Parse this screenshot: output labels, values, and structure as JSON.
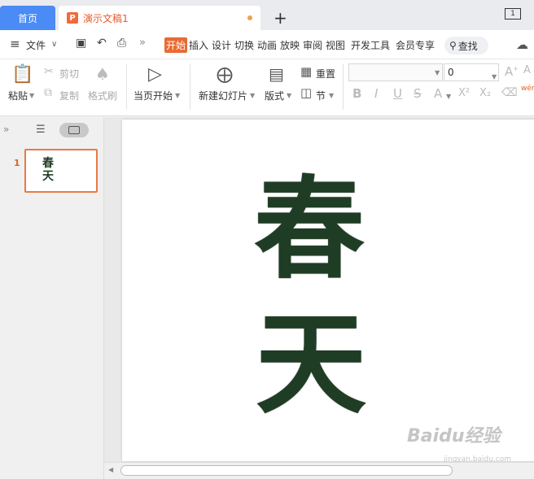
{
  "tabs": {
    "home_label": "首页",
    "doc_icon": "P",
    "doc_title": "演示文稿1",
    "new_tab": "+",
    "window_layout": "1"
  },
  "menu": {
    "hamburger_icon": "≡",
    "file_label": "文件",
    "file_arrow": "∨",
    "more_icon": "»",
    "tabs": [
      "开始",
      "插入",
      "设计",
      "切换",
      "动画",
      "放映",
      "审阅",
      "视图",
      "开发工具",
      "会员专享"
    ],
    "search_label": "查找"
  },
  "ribbon": {
    "paste_label": "粘贴",
    "cut_label": "剪切",
    "copy_label": "复制",
    "format_painter_label": "格式刷",
    "start_from_current_label": "当页开始",
    "new_slide_label": "新建幻灯片",
    "layout_label": "版式",
    "reset_label": "重置",
    "section_label": "节",
    "font_size_value": "0",
    "bold": "B",
    "italic": "I",
    "underline": "U",
    "strike": "S",
    "font_color": "A",
    "superscript": "X²",
    "subscript": "X₂",
    "pinyin": "wén"
  },
  "left_panel": {
    "collapse": "»",
    "slide_number": "1",
    "thumb_text_line1": "春",
    "thumb_text_line2": "天"
  },
  "slide": {
    "char1": "春",
    "char2": "天"
  },
  "watermark": {
    "text": "Baidu经验",
    "sub": "jingyan.baidu.com"
  },
  "colors": {
    "accent_orange": "#e96a33",
    "home_tab_blue": "#4a8bf5",
    "text_green": "#1f3d24"
  }
}
